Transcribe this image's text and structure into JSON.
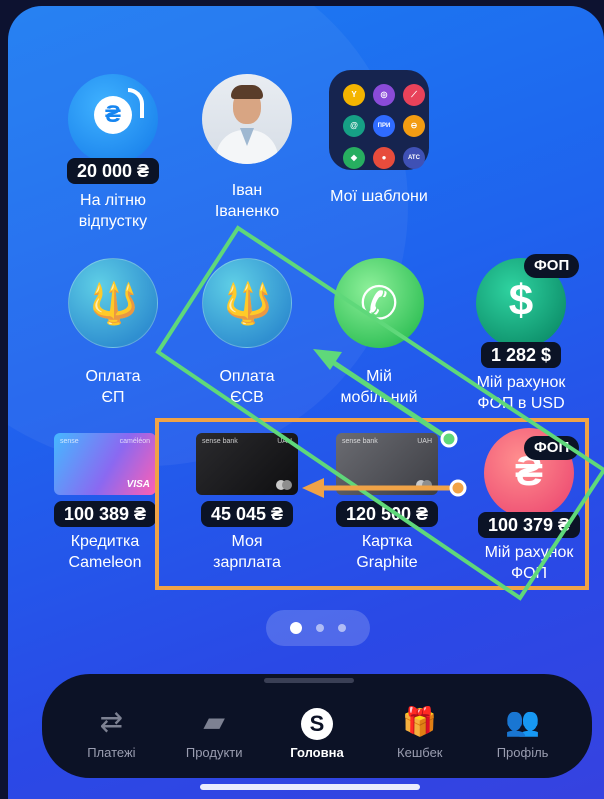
{
  "row1": [
    {
      "label": "На літню\nвідпустку",
      "amount": "20 000 ₴",
      "icon": "euro-savings-icon"
    },
    {
      "label": "Іван\nІваненко",
      "icon": "contact-avatar"
    },
    {
      "label": "Мої шаблони",
      "icon": "templates-grid-icon"
    }
  ],
  "templates": [
    "Y",
    "◎",
    "⟋",
    "@",
    "ПРИ",
    "⊖",
    "◆",
    "●",
    "ATC"
  ],
  "row2": [
    {
      "label": "Оплата\nЄП",
      "icon": "trident-icon"
    },
    {
      "label": "Оплата\nЄСВ",
      "icon": "trident-icon"
    },
    {
      "label": "Мій\nмобільний",
      "icon": "phone-icon"
    },
    {
      "label": "Мій рахунок\nФОП в USD",
      "amount": "1 282 $",
      "badge": "ФОП",
      "icon": "dollar-icon"
    }
  ],
  "row3": [
    {
      "label": "Кредитка\nCameleon",
      "amount": "100 389 ₴",
      "bank": "sense",
      "sub": "caméléon",
      "network": "VISA"
    },
    {
      "label": "Моя\nзарплата",
      "amount": "45 045 ₴",
      "bank": "sense bank",
      "sub": "UAH"
    },
    {
      "label": "Картка\nGraphite",
      "amount": "120 500 ₴",
      "bank": "sense bank",
      "sub": "UAH"
    },
    {
      "label": "Мій рахунок\nФОП",
      "amount": "100 379 ₴",
      "badge": "ФОП"
    }
  ],
  "glyphs": {
    "euro": "₴",
    "trident": "🔱",
    "phone": "✆",
    "dollar": "$",
    "hryvnia": "₴"
  },
  "pager": {
    "pages": 3,
    "active": 1
  },
  "nav": [
    {
      "label": "Платежі",
      "icon": "transfer-arrows-icon",
      "glyph": "⇄"
    },
    {
      "label": "Продукти",
      "icon": "cards-stack-icon",
      "glyph": "▰"
    },
    {
      "label": "Головна",
      "icon": "sense-logo-icon",
      "glyph": "S",
      "active": true
    },
    {
      "label": "Кешбек",
      "icon": "gift-icon",
      "glyph": "🎁"
    },
    {
      "label": "Профіль",
      "icon": "users-icon",
      "glyph": "👥"
    }
  ],
  "colors": {
    "highlight_orange": "#f0a347",
    "highlight_green": "#5fd87a",
    "accent_blue": "#1f63ee"
  }
}
